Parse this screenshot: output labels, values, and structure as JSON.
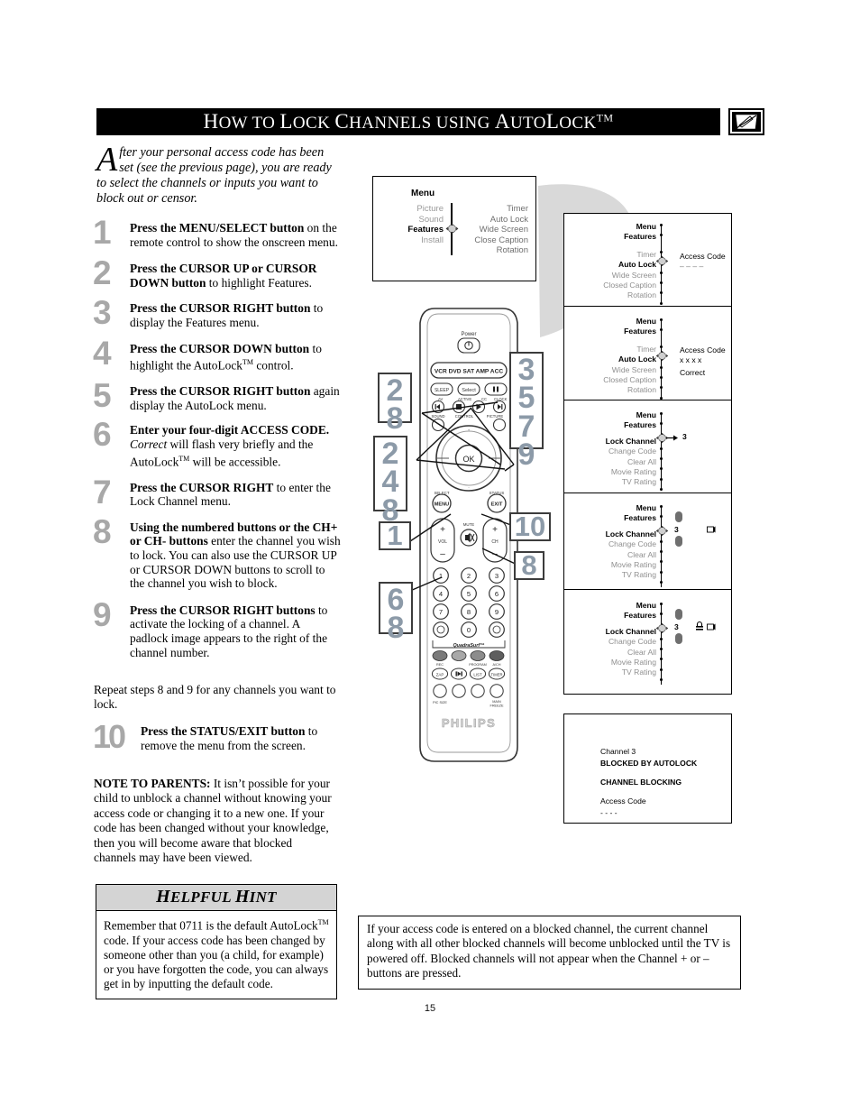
{
  "header": {
    "title_parts": [
      "H",
      "OW TO ",
      "L",
      "OCK ",
      "C",
      "HANNELS USING ",
      "A",
      "UTO",
      "L",
      "OCK"
    ],
    "title_plain": "How to Lock Channels using AutoLock",
    "trademark": "TM",
    "icon": "tv-screen-pencil-icon"
  },
  "intro": {
    "dropcap": "A",
    "text": "fter your personal access code has been set (see the previous page), you are ready to select the channels or inputs you want to block out or censor."
  },
  "steps": [
    {
      "num": "1",
      "bold": "Press the MENU/SELECT button",
      "rest": " on the remote control to show the onscreen menu."
    },
    {
      "num": "2",
      "bold": "Press the CURSOR UP or CURSOR DOWN button",
      "rest": " to highlight Features."
    },
    {
      "num": "3",
      "bold": "Press the CURSOR RIGHT button",
      "rest": " to display the Features menu."
    },
    {
      "num": "4",
      "bold": "Press the CURSOR DOWN button",
      "rest": " to highlight the AutoLock™ control."
    },
    {
      "num": "5",
      "bold": "Press the CURSOR RIGHT button",
      "rest": " again display the AutoLock menu."
    },
    {
      "num": "6",
      "bold": "Enter your four-digit ACCESS CODE.",
      "italic": " Correct",
      "rest": " will flash very briefly and the AutoLock™ will be accessible."
    },
    {
      "num": "7",
      "bold": "Press the CURSOR RIGHT",
      "rest": " to enter the Lock Channel menu."
    },
    {
      "num": "8",
      "bold": "Using the numbered buttons or the CH+ or CH- buttons",
      "rest": " enter the channel you wish to lock. You can also use the CURSOR UP or CURSOR DOWN buttons to scroll to the channel you wish to block."
    },
    {
      "num": "9",
      "bold": "Press the CURSOR RIGHT buttons",
      "rest": " to activate the locking of a channel. A padlock image appears to the right of the channel number."
    },
    {
      "num": "10",
      "bold": "Press the STATUS/EXIT button",
      "rest": " to remove the menu from the screen."
    }
  ],
  "repeat_note": "Repeat steps 8 and 9 for any channels you want to lock.",
  "parents_note": {
    "label": "NOTE TO PARENTS:",
    "text": "  It isn’t possible for your child to unblock a channel without knowing your access code or changing it to a new one.  If your code has been changed without your knowledge,  then you will become aware that blocked channels may have been viewed."
  },
  "hint": {
    "title": "HELPFUL HINT",
    "body": "Remember that 0711 is the default AutoLock™ code.  If your access code has been changed by someone other than you (a child, for example) or you have forgotten the code, you can always get in by inputting the default code."
  },
  "osd_top": {
    "title": "Menu",
    "left_items": [
      "Picture",
      "Sound",
      "Features",
      "Install"
    ],
    "selected": "Features",
    "right_items": [
      "Timer",
      "Auto Lock",
      "Wide Screen",
      "Close Caption",
      "Rotation"
    ]
  },
  "osd_panels": [
    {
      "id": "panel-access-code-empty",
      "breadcrumb": [
        "Menu",
        "Features"
      ],
      "items": [
        "Timer",
        "Auto Lock",
        "Wide Screen",
        "Closed Caption",
        "Rotation"
      ],
      "selected": "Auto Lock",
      "right_lines": [
        "Access Code",
        "– – – –"
      ]
    },
    {
      "id": "panel-access-code-correct",
      "breadcrumb": [
        "Menu",
        "Features"
      ],
      "items": [
        "Timer",
        "Auto Lock",
        "Wide Screen",
        "Closed Caption",
        "Rotation"
      ],
      "selected": "Auto Lock",
      "right_lines": [
        "Access Code",
        "x x x x",
        "Correct"
      ]
    },
    {
      "id": "panel-lock-channel",
      "breadcrumb": [
        "Menu",
        "Features"
      ],
      "items": [
        "Lock Channel",
        "Change Code",
        "Clear All",
        "Movie Rating",
        "TV Rating"
      ],
      "selected": "Lock Channel",
      "channel": "3",
      "right_lines": []
    },
    {
      "id": "panel-lock-channel-scroll",
      "breadcrumb": [
        "Menu",
        "Features"
      ],
      "items": [
        "Lock Channel",
        "Change Code",
        "Clear All",
        "Movie Rating",
        "TV Rating"
      ],
      "selected": "Lock Channel",
      "channel": "3",
      "right_lines": []
    },
    {
      "id": "panel-lock-channel-locked",
      "breadcrumb": [
        "Menu",
        "Features"
      ],
      "items": [
        "Lock Channel",
        "Change Code",
        "Clear All",
        "Movie Rating",
        "TV Rating"
      ],
      "selected": "Lock Channel",
      "channel": "3",
      "right_lines": []
    }
  ],
  "osd_message": {
    "line1": "Channel 3",
    "line2": "BLOCKED BY AUTOLOCK",
    "line3": "CHANNEL BLOCKING",
    "line4": "Access Code",
    "line5": "- - - -"
  },
  "note_box": {
    "text": "If your access code is entered on a blocked channel, the current channel along with all other blocked channels will become unblocked until the TV is powered off. Blocked channels will not appear when the Channel + or – buttons are pressed."
  },
  "callouts": {
    "left_top": [
      "2",
      "8"
    ],
    "left_mid": [
      "2",
      "4",
      "8"
    ],
    "left_bottom": [
      "1"
    ],
    "left_keypad": [
      "6",
      "8"
    ],
    "right_top": [
      "3",
      "5",
      "7",
      "9"
    ],
    "right_ten": [
      "10"
    ],
    "right_eight": [
      "8"
    ]
  },
  "remote": {
    "power_label": "Power",
    "mode_buttons": "VCR DVD SAT AMP ACC",
    "sleep": "SLEEP",
    "select": "Select",
    "pause_icon": "pause-icon",
    "row_labels": [
      "AV",
      "ACTIVE",
      "CC",
      "CLOCK"
    ],
    "transport_labels": [
      "SOUND",
      "CONTROL",
      "PICTURE"
    ],
    "ok": "OK",
    "menu": "MENU",
    "menu_top": "SELECT",
    "exit": "EXIT",
    "exit_top": "STATUS",
    "vol": "VOL",
    "ch": "CH",
    "mute": "MUTE",
    "keypad": [
      "1",
      "2",
      "3",
      "4",
      "5",
      "6",
      "7",
      "8",
      "9",
      "0"
    ],
    "quadrasurf": "QuadraSurf™",
    "bottom_labels": [
      "REC",
      "PROGRAM",
      "A/CH",
      "PIC SIZE",
      "MAIN/FREEZE"
    ],
    "brand": "PHILIPS"
  },
  "page_number": "15",
  "colors": {
    "header_bg": "#000000",
    "step_number": "#a8a8a8",
    "callout_number": "#8c9aa8",
    "hint_title_bg": "#d4d4d4",
    "osd_dim_text": "#8f8f8f"
  }
}
